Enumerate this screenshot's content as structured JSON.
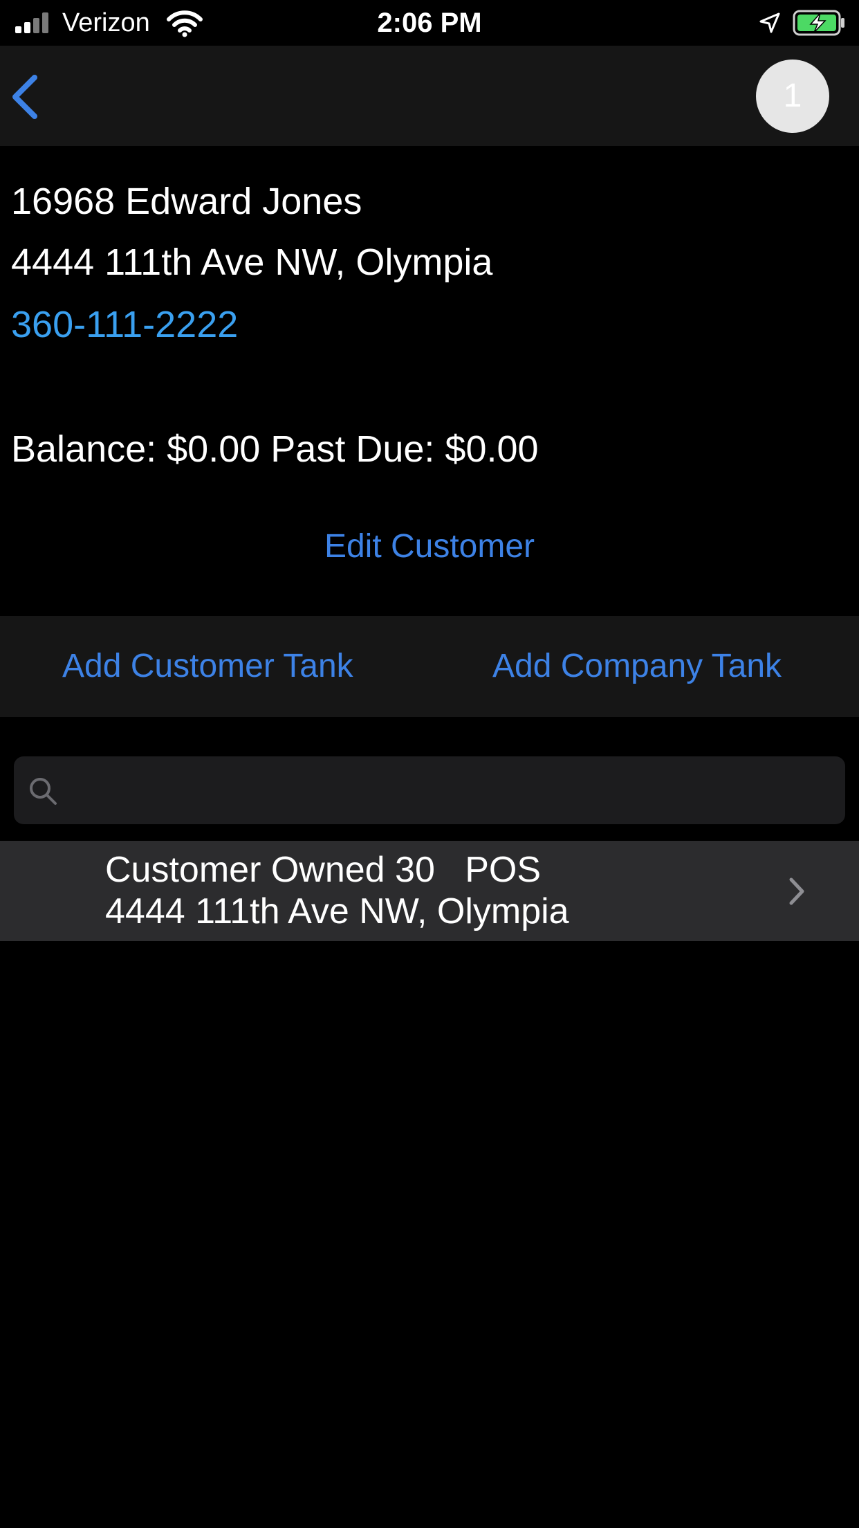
{
  "status_bar": {
    "carrier": "Verizon",
    "time": "2:06 PM",
    "signal_bars_active": 2,
    "signal_bars_total": 4,
    "battery_state": "charging",
    "battery_color": "#4cd964"
  },
  "nav": {
    "back_icon": "chevron-left-icon",
    "badge_count": "1"
  },
  "customer": {
    "title": "16968 Edward Jones",
    "address": "4444 111th Ave NW, Olympia",
    "phone": "360-111-2222",
    "balance_line": "Balance: $0.00  Past Due: $0.00",
    "edit_label": "Edit Customer"
  },
  "actions": {
    "add_customer_tank": "Add Customer Tank",
    "add_company_tank": "Add Company Tank"
  },
  "search": {
    "placeholder": "",
    "value": ""
  },
  "tanks": [
    {
      "title": "Customer Owned 30   POS",
      "address": "4444 111th Ave NW, Olympia"
    }
  ],
  "colors": {
    "accent": "#3d82e6",
    "phone_link": "#3aa0f0",
    "bar_background": "#161616",
    "row_background": "#2c2c2e"
  }
}
